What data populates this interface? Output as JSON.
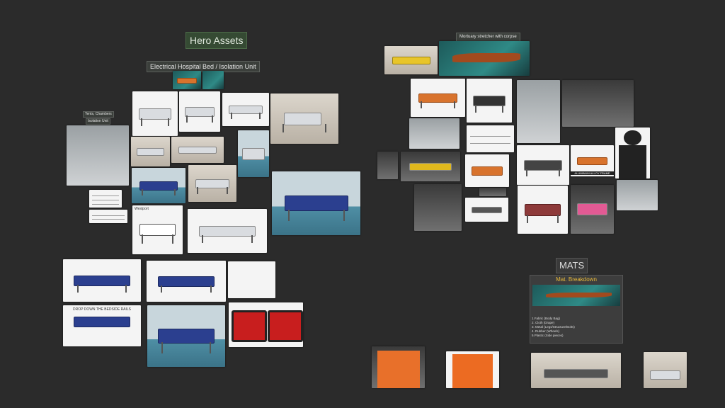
{
  "board": {
    "hero_title": "Hero Assets",
    "bed_section_label": "Electrical Hospital Bed / Isolation Unit",
    "small_label_line1": "Tents, Chambers",
    "small_label_line2": "Isolation Unit",
    "mortuary_label": "Mortuary stretcher with corpse",
    "mats_title": "MATS"
  },
  "mat_breakdown": {
    "title": "Mat. Breakdown",
    "items": [
      "1.Fabric (Body Bag)",
      "2. Cloth (Drape)",
      "3. Metal (Legs/Structure/Bolts)",
      "4. Rubber (Wheels)",
      "5.Plastic (Side pieces)"
    ]
  },
  "thumb_captions": {
    "bed_drawing_title": "Westport",
    "bed_spec_caption": "DROP DOWN THE BEDSIDE RAILS",
    "stretcher_caption": "ALUMINUM ALLOY FRAME"
  },
  "colors": {
    "background": "#2b2b2b",
    "accent_label": "#354a33",
    "breakdown_title": "#e7b93b"
  }
}
